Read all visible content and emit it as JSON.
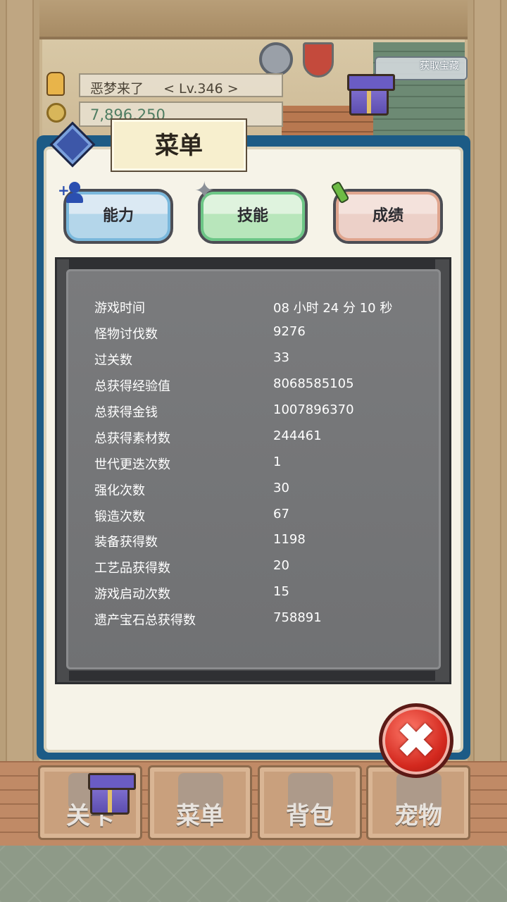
{
  "hud": {
    "player_name": "恶梦来了",
    "level": "< Lv.346 >",
    "gold": "7,896,250",
    "get_treasure_label": "获取宝藏"
  },
  "menu": {
    "title": "菜单",
    "tabs": [
      {
        "label": "能力"
      },
      {
        "label": "技能"
      },
      {
        "label": "成绩"
      }
    ],
    "stats": [
      {
        "label": "游戏时间",
        "value": "08 小时 24 分 10 秒"
      },
      {
        "label": "怪物讨伐数",
        "value": "9276"
      },
      {
        "label": "过关数",
        "value": "33"
      },
      {
        "label": "总获得经验值",
        "value": "8068585105"
      },
      {
        "label": "总获得金钱",
        "value": "1007896370"
      },
      {
        "label": "总获得素材数",
        "value": "244461"
      },
      {
        "label": "世代更迭次数",
        "value": "1"
      },
      {
        "label": "强化次数",
        "value": "30"
      },
      {
        "label": "锻造次数",
        "value": "67"
      },
      {
        "label": "装备获得数",
        "value": "1198"
      },
      {
        "label": "工艺品获得数",
        "value": "20"
      },
      {
        "label": "游戏启动次数",
        "value": "15"
      },
      {
        "label": "遗产宝石总获得数",
        "value": "758891"
      }
    ],
    "close_symbol": "✖"
  },
  "bottom_nav": [
    {
      "label": "关卡"
    },
    {
      "label": "菜单"
    },
    {
      "label": "背包"
    },
    {
      "label": "宠物"
    }
  ],
  "colors": {
    "panel_frame": "#1c5b86",
    "stats_bg": "#747577",
    "close_red": "#d3281e"
  }
}
